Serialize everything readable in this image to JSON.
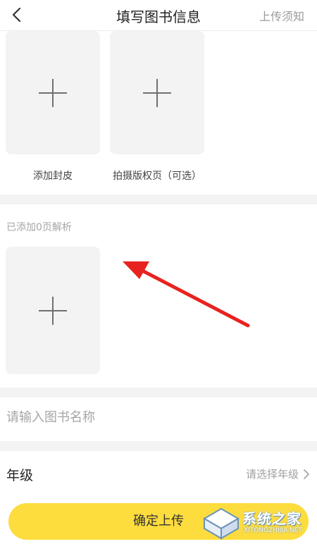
{
  "header": {
    "title": "填写图书信息",
    "notice_label": "上传须知"
  },
  "cover_section": {
    "items": [
      {
        "caption": "添加封皮"
      },
      {
        "caption": "拍摄版权页（可选）"
      }
    ]
  },
  "analysis_section": {
    "label": "已添加0页解析"
  },
  "book_name": {
    "value": "",
    "placeholder": "请输入图书名称"
  },
  "grade": {
    "label": "年级",
    "placeholder": "请选择年级"
  },
  "submit": {
    "label": "确定上传"
  },
  "watermark": {
    "text": "系统之家",
    "subtext": "XITONGZHIJIA.NET"
  },
  "colors": {
    "accent_yellow": "#fddc3e",
    "arrow_red": "#e8231f",
    "tile_gray": "#f3f3f3"
  }
}
